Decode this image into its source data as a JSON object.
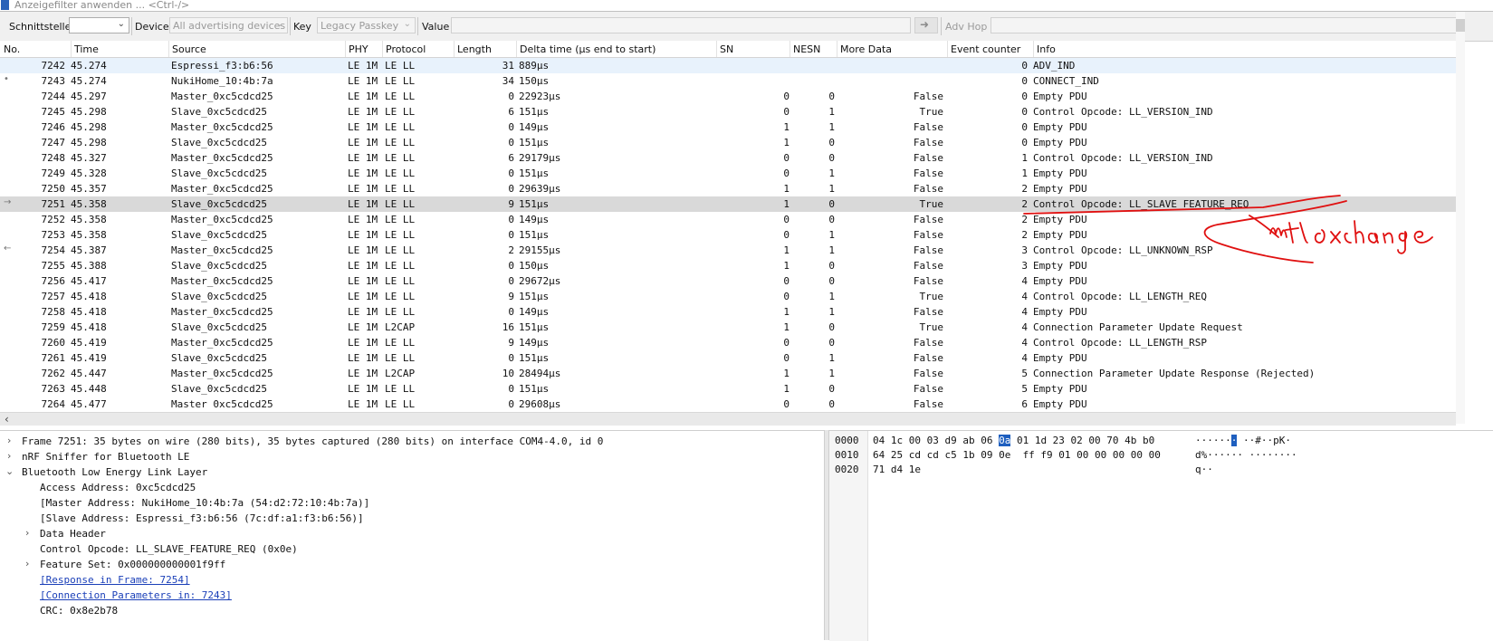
{
  "filter": {
    "placeholder": "Anzeigefilter anwenden ... <Ctrl-/>"
  },
  "toolbar": {
    "interface_label": "Schnittstelle",
    "interface_value": "",
    "device_label": "Device",
    "device_value": "All advertising devices",
    "key_label": "Key",
    "key_value": "Legacy Passkey",
    "value_label": "Value",
    "value_value": "",
    "adv_hop_label": "Adv Hop"
  },
  "columns": {
    "no": "No.",
    "time": "Time",
    "source": "Source",
    "phy": "PHY",
    "protocol": "Protocol",
    "length": "Length",
    "delta": "Delta time (µs end to start)",
    "sn": "SN",
    "nesn": "NESN",
    "more": "More Data",
    "event": "Event counter",
    "info": "Info"
  },
  "packets": [
    {
      "no": "7242",
      "time": "45.274",
      "source": "Espressi_f3:b6:56",
      "phy": "LE 1M",
      "protocol": "LE LL",
      "length": "31",
      "delta": "889µs",
      "sn": "",
      "nesn": "",
      "more": "",
      "event": "0",
      "info": "ADV_IND",
      "mark": ""
    },
    {
      "no": "7243",
      "time": "45.274",
      "source": "NukiHome_10:4b:7a",
      "phy": "LE 1M",
      "protocol": "LE LL",
      "length": "34",
      "delta": "150µs",
      "sn": "",
      "nesn": "",
      "more": "",
      "event": "0",
      "info": "CONNECT_IND",
      "mark": "•"
    },
    {
      "no": "7244",
      "time": "45.297",
      "source": "Master_0xc5cdcd25",
      "phy": "LE 1M",
      "protocol": "LE LL",
      "length": "0",
      "delta": "22923µs",
      "sn": "0",
      "nesn": "0",
      "more": "False",
      "event": "0",
      "info": "Empty PDU",
      "mark": ""
    },
    {
      "no": "7245",
      "time": "45.298",
      "source": "Slave_0xc5cdcd25",
      "phy": "LE 1M",
      "protocol": "LE LL",
      "length": "6",
      "delta": "151µs",
      "sn": "0",
      "nesn": "1",
      "more": "True",
      "event": "0",
      "info": "Control Opcode: LL_VERSION_IND",
      "mark": ""
    },
    {
      "no": "7246",
      "time": "45.298",
      "source": "Master_0xc5cdcd25",
      "phy": "LE 1M",
      "protocol": "LE LL",
      "length": "0",
      "delta": "149µs",
      "sn": "1",
      "nesn": "1",
      "more": "False",
      "event": "0",
      "info": "Empty PDU",
      "mark": ""
    },
    {
      "no": "7247",
      "time": "45.298",
      "source": "Slave_0xc5cdcd25",
      "phy": "LE 1M",
      "protocol": "LE LL",
      "length": "0",
      "delta": "151µs",
      "sn": "1",
      "nesn": "0",
      "more": "False",
      "event": "0",
      "info": "Empty PDU",
      "mark": ""
    },
    {
      "no": "7248",
      "time": "45.327",
      "source": "Master_0xc5cdcd25",
      "phy": "LE 1M",
      "protocol": "LE LL",
      "length": "6",
      "delta": "29179µs",
      "sn": "0",
      "nesn": "0",
      "more": "False",
      "event": "1",
      "info": "Control Opcode: LL_VERSION_IND",
      "mark": ""
    },
    {
      "no": "7249",
      "time": "45.328",
      "source": "Slave_0xc5cdcd25",
      "phy": "LE 1M",
      "protocol": "LE LL",
      "length": "0",
      "delta": "151µs",
      "sn": "0",
      "nesn": "1",
      "more": "False",
      "event": "1",
      "info": "Empty PDU",
      "mark": ""
    },
    {
      "no": "7250",
      "time": "45.357",
      "source": "Master_0xc5cdcd25",
      "phy": "LE 1M",
      "protocol": "LE LL",
      "length": "0",
      "delta": "29639µs",
      "sn": "1",
      "nesn": "1",
      "more": "False",
      "event": "2",
      "info": "Empty PDU",
      "mark": ""
    },
    {
      "no": "7251",
      "time": "45.358",
      "source": "Slave_0xc5cdcd25",
      "phy": "LE 1M",
      "protocol": "LE LL",
      "length": "9",
      "delta": "151µs",
      "sn": "1",
      "nesn": "0",
      "more": "True",
      "event": "2",
      "info": "Control Opcode: LL_SLAVE_FEATURE_REQ",
      "mark": "→"
    },
    {
      "no": "7252",
      "time": "45.358",
      "source": "Master_0xc5cdcd25",
      "phy": "LE 1M",
      "protocol": "LE LL",
      "length": "0",
      "delta": "149µs",
      "sn": "0",
      "nesn": "0",
      "more": "False",
      "event": "2",
      "info": "Empty PDU",
      "mark": ""
    },
    {
      "no": "7253",
      "time": "45.358",
      "source": "Slave_0xc5cdcd25",
      "phy": "LE 1M",
      "protocol": "LE LL",
      "length": "0",
      "delta": "151µs",
      "sn": "0",
      "nesn": "1",
      "more": "False",
      "event": "2",
      "info": "Empty PDU",
      "mark": ""
    },
    {
      "no": "7254",
      "time": "45.387",
      "source": "Master_0xc5cdcd25",
      "phy": "LE 1M",
      "protocol": "LE LL",
      "length": "2",
      "delta": "29155µs",
      "sn": "1",
      "nesn": "1",
      "more": "False",
      "event": "3",
      "info": "Control Opcode: LL_UNKNOWN_RSP",
      "mark": "←"
    },
    {
      "no": "7255",
      "time": "45.388",
      "source": "Slave_0xc5cdcd25",
      "phy": "LE 1M",
      "protocol": "LE LL",
      "length": "0",
      "delta": "150µs",
      "sn": "1",
      "nesn": "0",
      "more": "False",
      "event": "3",
      "info": "Empty PDU",
      "mark": ""
    },
    {
      "no": "7256",
      "time": "45.417",
      "source": "Master_0xc5cdcd25",
      "phy": "LE 1M",
      "protocol": "LE LL",
      "length": "0",
      "delta": "29672µs",
      "sn": "0",
      "nesn": "0",
      "more": "False",
      "event": "4",
      "info": "Empty PDU",
      "mark": ""
    },
    {
      "no": "7257",
      "time": "45.418",
      "source": "Slave_0xc5cdcd25",
      "phy": "LE 1M",
      "protocol": "LE LL",
      "length": "9",
      "delta": "151µs",
      "sn": "0",
      "nesn": "1",
      "more": "True",
      "event": "4",
      "info": "Control Opcode: LL_LENGTH_REQ",
      "mark": ""
    },
    {
      "no": "7258",
      "time": "45.418",
      "source": "Master_0xc5cdcd25",
      "phy": "LE 1M",
      "protocol": "LE LL",
      "length": "0",
      "delta": "149µs",
      "sn": "1",
      "nesn": "1",
      "more": "False",
      "event": "4",
      "info": "Empty PDU",
      "mark": ""
    },
    {
      "no": "7259",
      "time": "45.418",
      "source": "Slave_0xc5cdcd25",
      "phy": "LE 1M",
      "protocol": "L2CAP",
      "length": "16",
      "delta": "151µs",
      "sn": "1",
      "nesn": "0",
      "more": "True",
      "event": "4",
      "info": "Connection Parameter Update Request",
      "mark": ""
    },
    {
      "no": "7260",
      "time": "45.419",
      "source": "Master_0xc5cdcd25",
      "phy": "LE 1M",
      "protocol": "LE LL",
      "length": "9",
      "delta": "149µs",
      "sn": "0",
      "nesn": "0",
      "more": "False",
      "event": "4",
      "info": "Control Opcode: LL_LENGTH_RSP",
      "mark": ""
    },
    {
      "no": "7261",
      "time": "45.419",
      "source": "Slave_0xc5cdcd25",
      "phy": "LE 1M",
      "protocol": "LE LL",
      "length": "0",
      "delta": "151µs",
      "sn": "0",
      "nesn": "1",
      "more": "False",
      "event": "4",
      "info": "Empty PDU",
      "mark": ""
    },
    {
      "no": "7262",
      "time": "45.447",
      "source": "Master_0xc5cdcd25",
      "phy": "LE 1M",
      "protocol": "L2CAP",
      "length": "10",
      "delta": "28494µs",
      "sn": "1",
      "nesn": "1",
      "more": "False",
      "event": "5",
      "info": "Connection Parameter Update Response (Rejected)",
      "mark": ""
    },
    {
      "no": "7263",
      "time": "45.448",
      "source": "Slave_0xc5cdcd25",
      "phy": "LE 1M",
      "protocol": "LE LL",
      "length": "0",
      "delta": "151µs",
      "sn": "1",
      "nesn": "0",
      "more": "False",
      "event": "5",
      "info": "Empty PDU",
      "mark": ""
    },
    {
      "no": "7264",
      "time": "45.477",
      "source": "Master 0xc5cdcd25",
      "phy": "LE 1M",
      "protocol": "LE LL",
      "length": "0",
      "delta": "29608µs",
      "sn": "0",
      "nesn": "0",
      "more": "False",
      "event": "6",
      "info": "Empty PDU",
      "mark": ""
    }
  ],
  "details": {
    "frame": "Frame 7251: 35 bytes on wire (280 bits), 35 bytes captured (280 bits) on interface COM4-4.0, id 0",
    "sniffer": "nRF Sniffer for Bluetooth LE",
    "ble": "Bluetooth Low Energy Link Layer",
    "access": "Access Address: 0xc5cdcd25",
    "master": "[Master Address: NukiHome_10:4b:7a (54:d2:72:10:4b:7a)]",
    "slave": "[Slave Address: Espressi_f3:b6:56 (7c:df:a1:f3:b6:56)]",
    "header": "Data Header",
    "opcode": "Control Opcode: LL_SLAVE_FEATURE_REQ (0x0e)",
    "features": "Feature Set: 0x000000000001f9ff",
    "response": "[Response in Frame: 7254]",
    "conn": "[Connection Parameters in: 7243]",
    "crc": "CRC: 0x8e2b78"
  },
  "bytes": {
    "r0_off": "0000",
    "r0_hex_a": "04 1c 00 03 d9 ab 06 ",
    "r0_sel": "0a",
    "r0_hex_b": " 01 1d 23 02 00 70 4b b0",
    "r0_asc_a": "······",
    "r0_asc_sel": "·",
    "r0_asc_b": " ··#··pK·",
    "r1_off": "0010",
    "r1_hex": "64 25 cd cd c5 1b 09 0e  ff f9 01 00 00 00 00 00",
    "r1_asc": "d%······ ········",
    "r2_off": "0020",
    "r2_hex": "71 d4 1e",
    "r2_asc": "q··"
  },
  "annotation": {
    "text": "mtu exchange",
    "color": "#e01010"
  }
}
